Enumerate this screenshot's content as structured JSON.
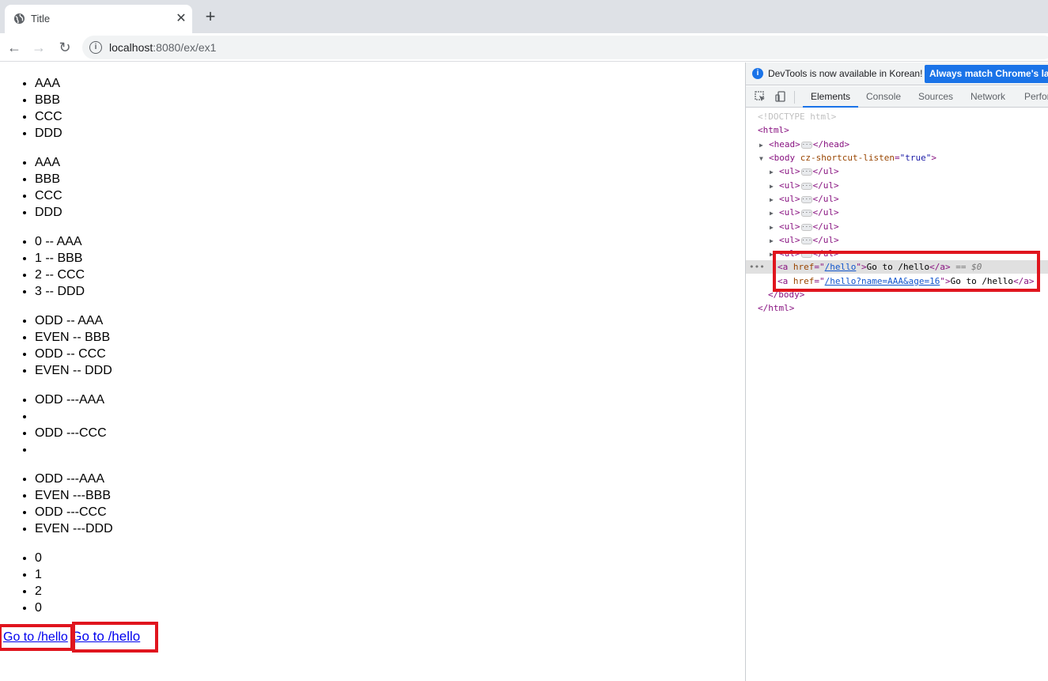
{
  "browser": {
    "tab_title": "Title",
    "close_glyph": "✕",
    "new_tab_glyph": "+",
    "url_host": "localhost",
    "url_path": ":8080/ex/ex1"
  },
  "page": {
    "list1": [
      "AAA",
      "BBB",
      "CCC",
      "DDD"
    ],
    "list2": [
      "AAA",
      "BBB",
      "CCC",
      "DDD"
    ],
    "list3": [
      "0 -- AAA",
      "1 -- BBB",
      "2 -- CCC",
      "3 -- DDD"
    ],
    "list4": [
      "ODD -- AAA",
      "EVEN -- BBB",
      "ODD -- CCC",
      "EVEN -- DDD"
    ],
    "list5": [
      "ODD ---AAA",
      "",
      "ODD ---CCC",
      ""
    ],
    "list6": [
      "ODD ---AAA",
      "EVEN ---BBB",
      "ODD ---CCC",
      "EVEN ---DDD"
    ],
    "list7": [
      "0",
      "1",
      "2",
      "0"
    ],
    "link1": "Go to /hello",
    "link2": "Go to /hello"
  },
  "devtools": {
    "info_message": "DevTools is now available in Korean!",
    "info_button": "Always match Chrome's language",
    "tabs": [
      "Elements",
      "Console",
      "Sources",
      "Network",
      "Performance"
    ],
    "dom": {
      "doctype": "<!DOCTYPE html>",
      "html_open": "<html>",
      "head_open": "<head>",
      "head_close": "</head>",
      "body_open": "<body",
      "body_attr": "cz-shortcut-listen",
      "body_val": "\"true\"",
      "ul_open": "<ul>",
      "ul_close": "</ul>",
      "a1_href": "/hello",
      "a1_text": "Go to /hello",
      "a2_href": "/hello?name=AAA&age=16",
      "a2_text": "Go to /hello",
      "selected_marker": "== $0",
      "body_close": "</body>",
      "html_close": "</html>"
    }
  }
}
